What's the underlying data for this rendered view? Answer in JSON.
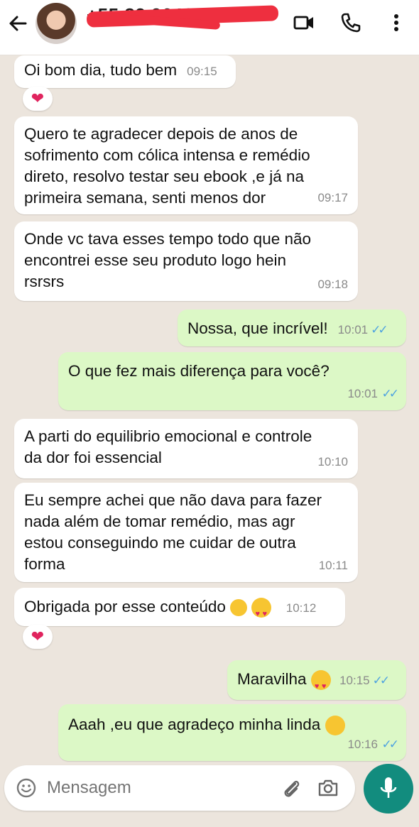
{
  "header": {
    "contact_name": "+55 82 9640 7084",
    "icons": [
      "back-arrow-icon",
      "video-call-icon",
      "phone-icon",
      "more-vert-icon"
    ]
  },
  "messages": [
    {
      "dir": "in",
      "text": "Oi bom dia, tudo bem",
      "time": "09:15",
      "reaction": "❤"
    },
    {
      "dir": "in",
      "lines": [
        "Quero te agradecer depois de anos de",
        "sofrimento com cólica intensa e remédio",
        "direto, resolvo testar seu ebook ,e já na",
        "primeira semana, senti menos dor"
      ],
      "time": "09:17"
    },
    {
      "dir": "in",
      "lines": [
        "Onde vc tava esses tempo todo que não",
        "encontrei esse seu produto logo hein",
        "rsrsrs"
      ],
      "time": "09:18"
    },
    {
      "dir": "out",
      "text": "Nossa, que incrível!",
      "time": "10:01",
      "ticks": "✓✓"
    },
    {
      "dir": "out",
      "text": "O que fez mais diferença para você?",
      "time": "10:01",
      "ticks": "✓✓"
    },
    {
      "dir": "in",
      "lines": [
        "A parti do equilibrio emocional e controle",
        "da dor foi essencial"
      ],
      "time": "10:10"
    },
    {
      "dir": "in",
      "lines": [
        "Eu sempre achei que não dava para fazer",
        "nada além de tomar remédio, mas agr",
        "estou conseguindo me cuidar de outra",
        "forma"
      ],
      "time": "10:11"
    },
    {
      "dir": "in",
      "text": "Obrigada por esse conteúdo",
      "emojis": [
        "pleading-face",
        "heart-eyes"
      ],
      "time": "10:12",
      "reaction": "❤"
    },
    {
      "dir": "out",
      "text": "Maravilha",
      "emojis": [
        "heart-eyes"
      ],
      "time": "10:15",
      "ticks": "✓✓"
    },
    {
      "dir": "out",
      "text": "Aaah ,eu que agradeço minha linda",
      "emojis": [
        "winking-face"
      ],
      "time": "10:16",
      "ticks": "✓✓"
    }
  ],
  "input": {
    "placeholder": "Mensagem",
    "icons": [
      "emoji-icon",
      "attach-icon",
      "camera-icon",
      "mic-icon"
    ]
  }
}
